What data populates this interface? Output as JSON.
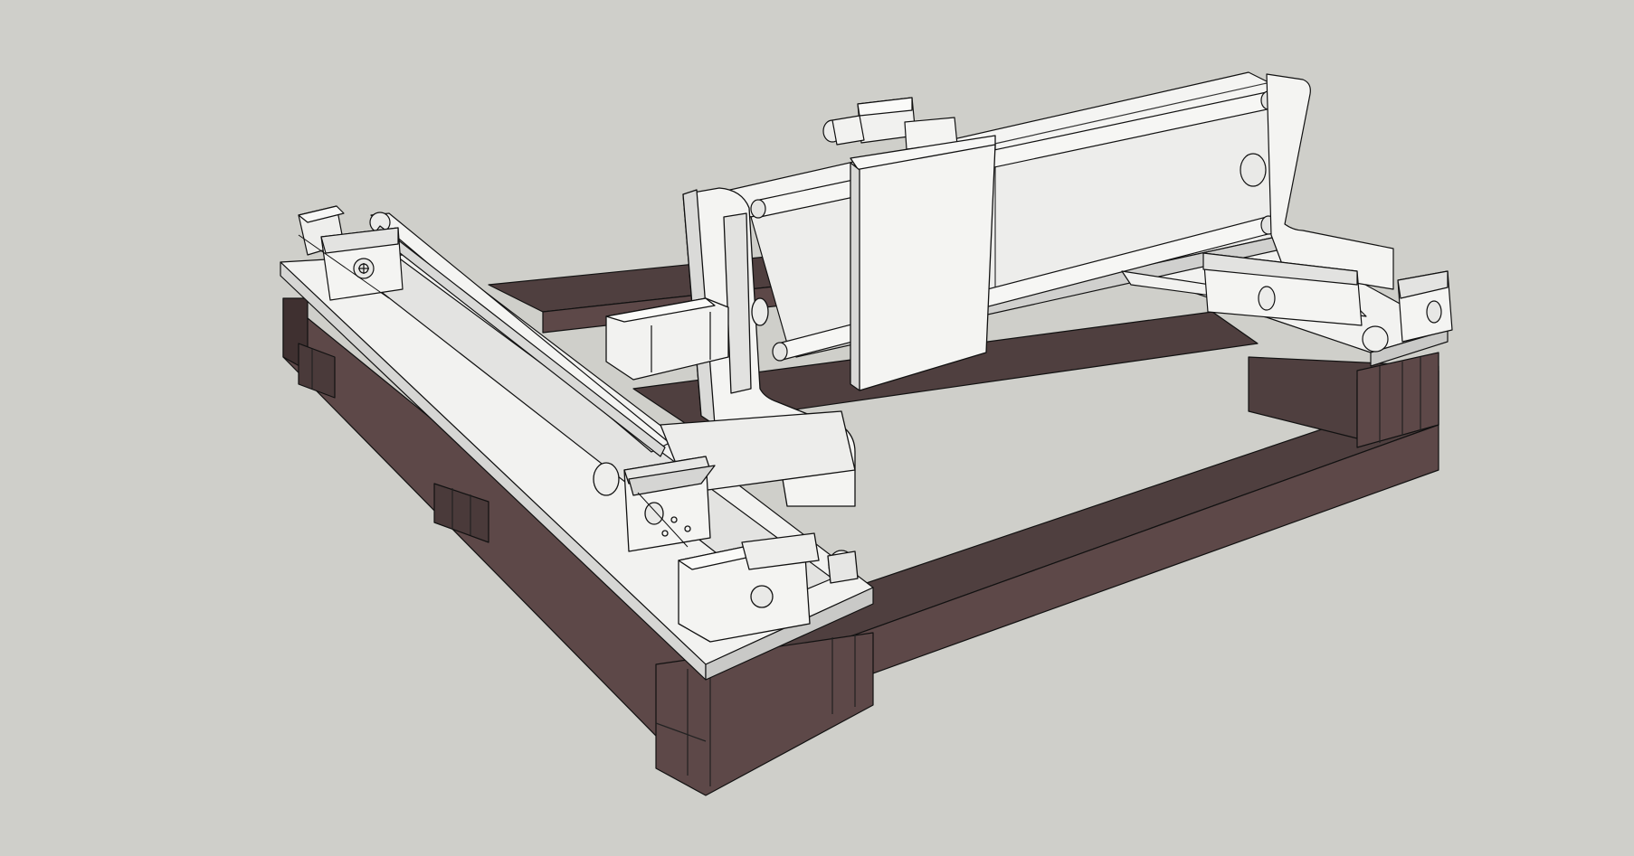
{
  "scene": {
    "subject": "",
    "colors": {
      "background": "#cfcfca",
      "frame_top": "#4f3f3f",
      "frame_side": "#5d4848",
      "frame_dark": "#3f3030",
      "part_light": "#f4f4f2",
      "part_mid": "#e3e3e1",
      "part_shadow": "#c9c9c7",
      "edge": "#111111"
    },
    "components": [
      "base-frame",
      "left-bed-plate",
      "right-bed-plate",
      "y-axis-rails",
      "y-axis-motors",
      "gantry-beam",
      "gantry-rails",
      "x-carriage-plate",
      "x-axis-motor",
      "gantry-side-plates",
      "bearing-blocks"
    ]
  }
}
